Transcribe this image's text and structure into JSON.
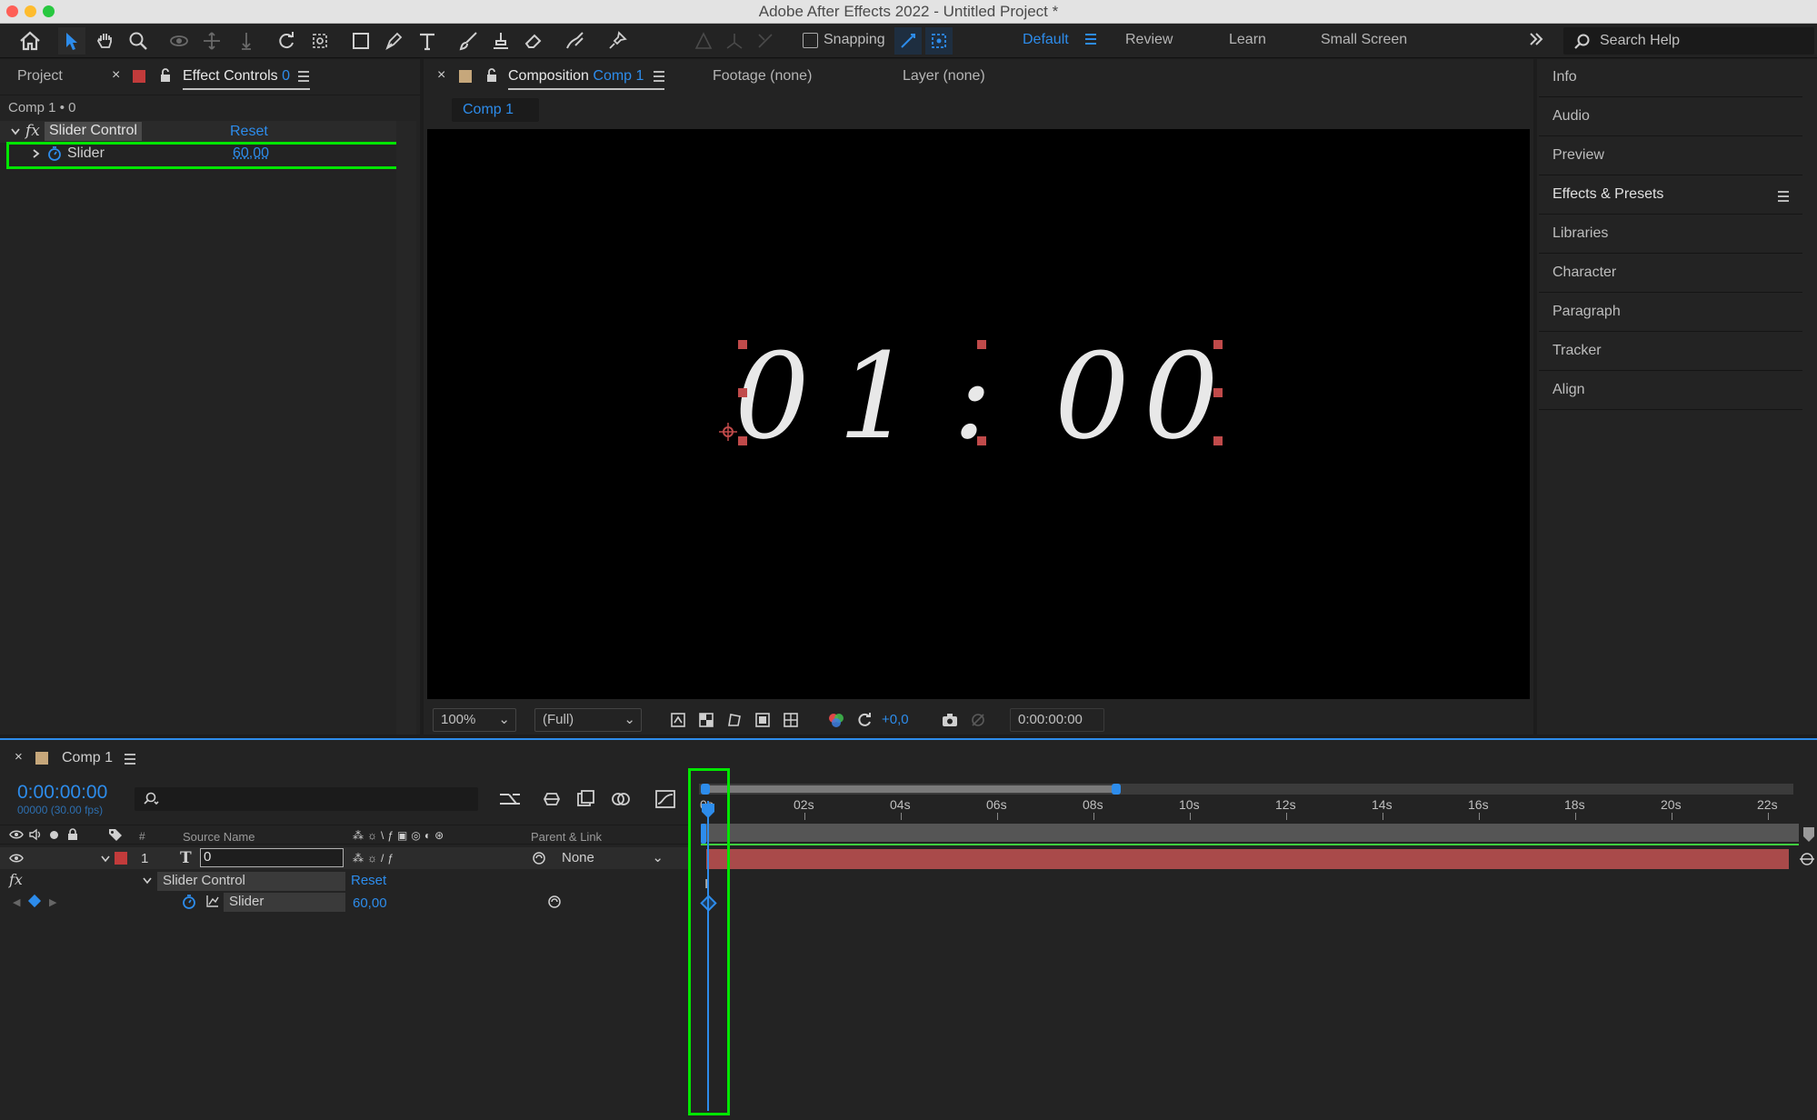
{
  "window": {
    "title": "Adobe After Effects 2022 - Untitled Project *"
  },
  "toolbar": {
    "snapping_label": "Snapping",
    "workspaces": [
      "Default",
      "Review",
      "Learn",
      "Small Screen"
    ],
    "search_placeholder": "Search Help",
    "active_workspace_color": "#2d8ceb"
  },
  "left_panel": {
    "tab_project": "Project",
    "tab_effect_controls": "Effect Controls",
    "tab_effect_controls_layer": "0",
    "breadcrumb": "Comp 1 • 0",
    "effect": {
      "name": "Slider Control",
      "reset": "Reset"
    },
    "property": {
      "name": "Slider",
      "value": "60,00"
    }
  },
  "center_panel": {
    "tab_composition": "Composition",
    "tab_composition_name": "Comp 1",
    "tab_footage": "Footage (none)",
    "tab_layer": "Layer (none)",
    "comp_chip": "Comp 1",
    "display_text": {
      "d1": "0",
      "d2": "1",
      "colon": ":",
      "d3": "0",
      "d4": "0"
    },
    "zoom": "100%",
    "resolution": "(Full)",
    "exposure": "+0,0",
    "timecode": "0:00:00:00"
  },
  "right_panel": {
    "items": [
      "Info",
      "Audio",
      "Preview",
      "Effects & Presets",
      "Libraries",
      "Character",
      "Paragraph",
      "Tracker",
      "Align"
    ]
  },
  "timeline": {
    "comp_tab": "Comp 1",
    "timecode": "0:00:00:00",
    "frame_info": "00000 (30.00 fps)",
    "col_hash": "#",
    "col_source_name": "Source Name",
    "col_parent": "Parent & Link",
    "layer": {
      "index": "1",
      "name": "0",
      "parent": "None"
    },
    "effect": {
      "name": "Slider Control",
      "reset": "Reset"
    },
    "property": {
      "name": "Slider",
      "value": "60,00"
    },
    "ruler": [
      "0s",
      "02s",
      "04s",
      "06s",
      "08s",
      "10s",
      "12s",
      "14s",
      "16s",
      "18s",
      "20s",
      "22s"
    ],
    "layer_bar_color": "#a94a4a",
    "highlight_color": "#00e600"
  }
}
